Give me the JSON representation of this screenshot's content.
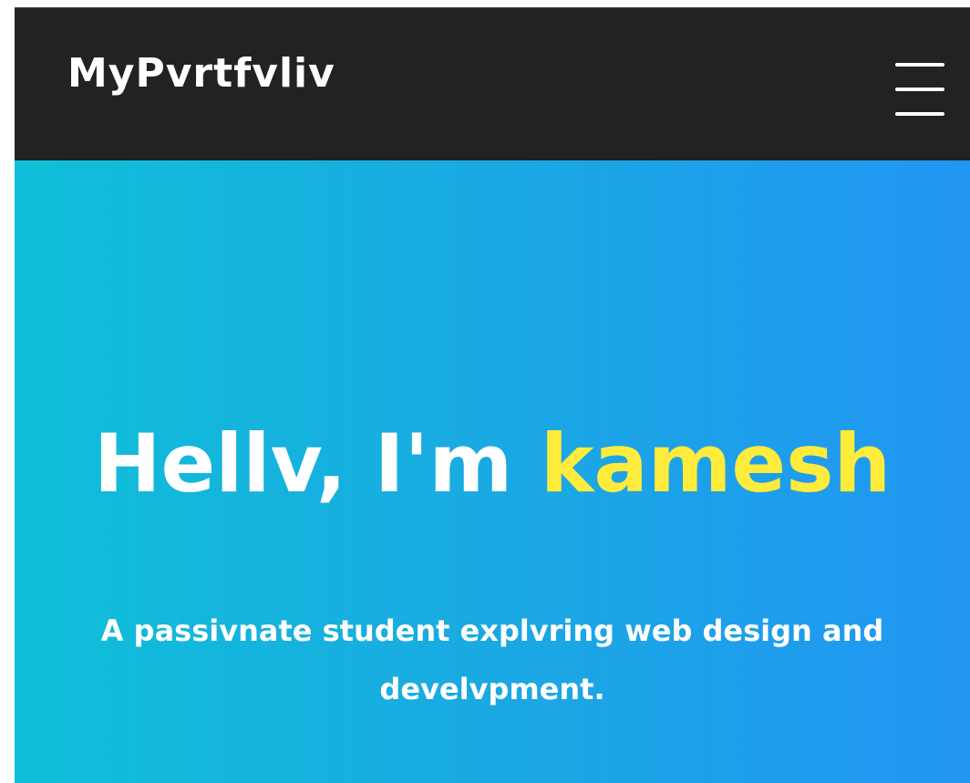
{
  "navbar": {
    "brand": "MyPvrtfvliv",
    "menu_icon": "hamburger-menu-icon",
    "background": "#222222"
  },
  "hero": {
    "greeting": "Hellv, I'm ",
    "name": "kamesh",
    "tagline": "A passivnate student explvring web design and develvpment.",
    "gradient_start": "#0fbfd8",
    "gradient_end": "#2196f3",
    "name_color": "#ffeb3b"
  }
}
